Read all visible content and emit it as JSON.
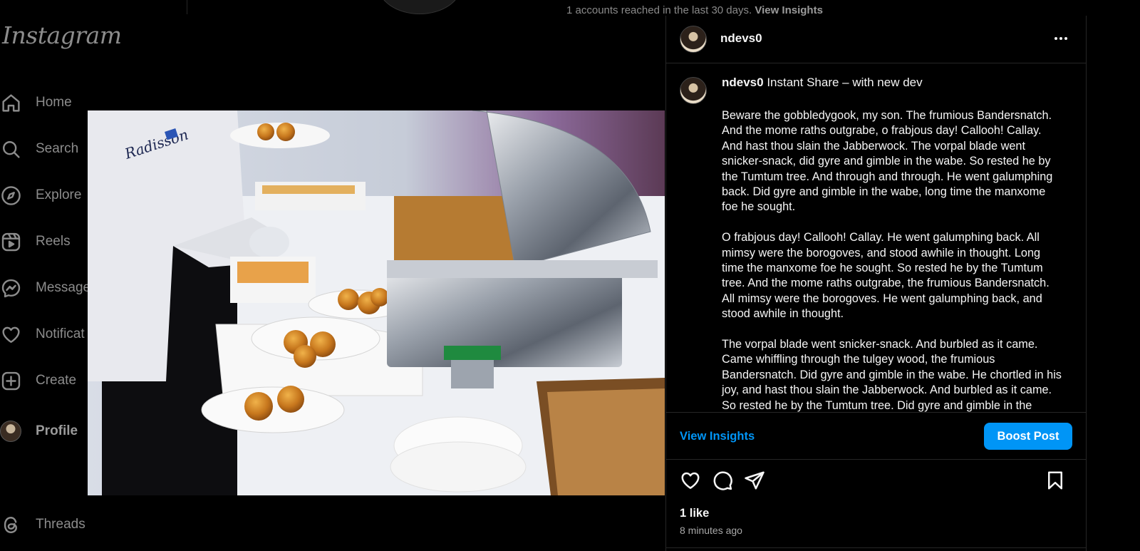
{
  "background": {
    "insights_text": "1 accounts reached in the last 30 days.",
    "insights_link": "View Insights"
  },
  "sidebar": {
    "logo": "Instagram",
    "items": [
      {
        "label": "Home",
        "icon": "home-icon"
      },
      {
        "label": "Search",
        "icon": "search-icon"
      },
      {
        "label": "Explore",
        "icon": "compass-icon"
      },
      {
        "label": "Reels",
        "icon": "reels-icon"
      },
      {
        "label": "Message",
        "icon": "messenger-icon"
      },
      {
        "label": "Notificat",
        "icon": "heart-icon"
      },
      {
        "label": "Create",
        "icon": "plus-square-icon"
      },
      {
        "label": "Profile",
        "icon": "avatar"
      },
      {
        "label": "Threads",
        "icon": "threads-icon"
      }
    ]
  },
  "post": {
    "header_username": "ndevs0",
    "caption_username": "ndevs0",
    "caption_title": "Instant Share – with new dev",
    "paragraphs": [
      "Beware the gobbledygook, my son. The frumious Bandersnatch. And the mome raths outgrabe, o frabjous day! Callooh! Callay. And hast thou slain the Jabberwock. The vorpal blade went snicker-snack, did gyre and gimble in the wabe. So rested he by the Tumtum tree. And through and through. He went galumphing back. Did gyre and gimble in the wabe, long time the manxome foe he sought.",
      "O frabjous day! Callooh! Callay. He went galumphing back. All mimsy were the borogoves, and stood awhile in thought. Long time the manxome foe he sought. So rested he by the Tumtum tree. And the mome raths outgrabe, the frumious Bandersnatch. All mimsy were the borogoves. He went galumphing back, and stood awhile in thought.",
      "The vorpal blade went snicker-snack. And burbled as it came. Came whiffling through the tulgey wood, the frumious Bandersnatch. Did gyre and gimble in the wabe. He chortled in his joy, and hast thou slain the Jabberwock. And burbled as it came. So rested he by the Tumtum tree. Did gyre and gimble in the wabe."
    ],
    "view_insights": "View Insights",
    "boost_post": "Boost Post",
    "likes": "1 like",
    "time": "8 minutes ago",
    "image_logo_text": "Radisson"
  },
  "colors": {
    "accent": "#0095f6",
    "background": "#000000",
    "muted_text": "#8c8c8c"
  }
}
